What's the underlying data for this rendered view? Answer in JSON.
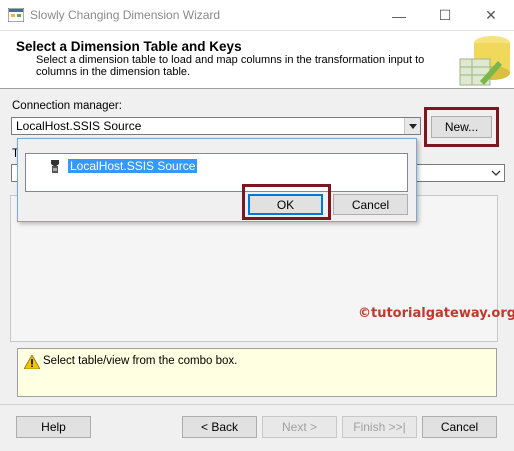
{
  "window": {
    "title": "Slowly Changing Dimension Wizard",
    "controls": {
      "minimize": "—",
      "maximize": "☐",
      "close": "✕"
    }
  },
  "header": {
    "title": "Select a Dimension Table and Keys",
    "description": "Select a dimension table to load and map columns in the transformation input to columns in the dimension table."
  },
  "connection": {
    "label": "Connection manager:",
    "value": "LocalHost.SSIS Source",
    "new_button": "New..."
  },
  "table": {
    "label_partial": "T"
  },
  "popup": {
    "item": "LocalHost.SSIS Source",
    "ok": "OK",
    "cancel": "Cancel"
  },
  "watermark": "©tutorialgateway.org",
  "status": {
    "message": "Select table/view from the combo box."
  },
  "footer": {
    "help": "Help",
    "back": "< Back",
    "next": "Next >",
    "finish": "Finish >>|",
    "cancel": "Cancel"
  },
  "colors": {
    "highlight": "#7a1720",
    "selection": "#3399ff",
    "status_bg": "#ffffe1",
    "watermark": "#c0392b"
  }
}
